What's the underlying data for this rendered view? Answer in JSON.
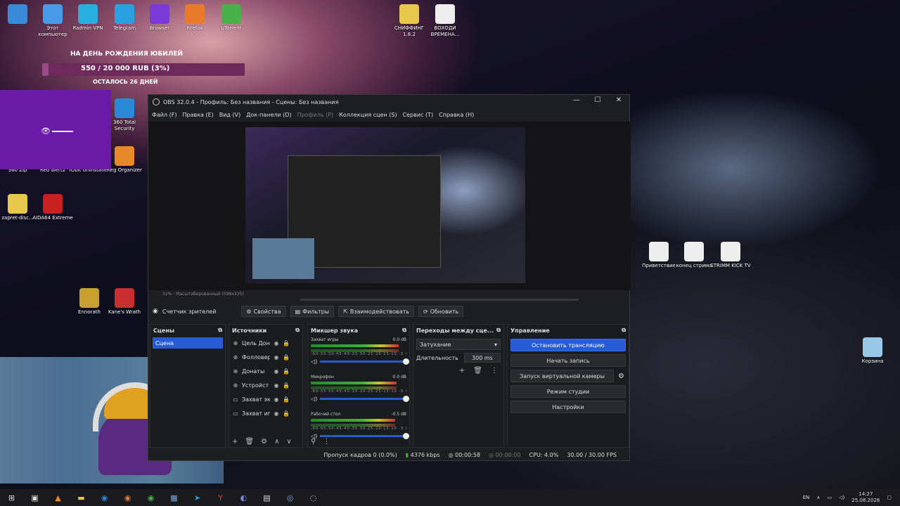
{
  "desktop": {
    "icons_top": [
      {
        "label": "",
        "color": "#3a8ad8"
      },
      {
        "label": "Этот компьютер",
        "color": "#4a9ae8"
      },
      {
        "label": "Radmin VPN",
        "color": "#2ab0e0"
      },
      {
        "label": "Telegram",
        "color": "#2aa0e0"
      },
      {
        "label": "Browser",
        "color": "#7a3ad8"
      },
      {
        "label": "Firefox",
        "color": "#e87a2a"
      },
      {
        "label": "µTorrent",
        "color": "#4ab04a"
      }
    ],
    "icons_top_right": [
      {
        "label": "СНИФФИНГ 1.8.2",
        "color": "#e8c84a"
      },
      {
        "label": "ВОХОДИ ВРЕМЕНА...",
        "color": "#eeeeee"
      }
    ],
    "icons_left": [
      {
        "label": "360 Total Security",
        "color": "#2a8ad8"
      },
      {
        "label": "Reg Organizer",
        "color": "#e88a2a"
      },
      {
        "label": "360 Zip",
        "color": "#3a6ad8"
      },
      {
        "label": "Red alert2",
        "color": "#c83030"
      },
      {
        "label": "IObit Uninstaller",
        "color": "#2ab04a"
      },
      {
        "label": "zapret-disc...",
        "color": "#e8c84a"
      },
      {
        "label": "AIDA64 Extreme",
        "color": "#c82020"
      },
      {
        "label": "Ennorath",
        "color": "#c8a030"
      },
      {
        "label": "Kane's Wrath",
        "color": "#c83030"
      }
    ],
    "icons_right": [
      {
        "label": "Приветствие",
        "color": "#eeeeee"
      },
      {
        "label": "конец стрима",
        "color": "#eeeeee"
      },
      {
        "label": "STRIMM KICK TV",
        "color": "#eeeeee"
      },
      {
        "label": "Корзина",
        "color": "#9ac8e8"
      }
    ]
  },
  "donation": {
    "title": "НА ДЕНЬ РОЖДЕНИЯ ЮБИЛЕЙ",
    "progress_text": "550 / 20 000 RUB (3%)",
    "progress_fraction": 0.03,
    "days_left": "ОСТАЛОСЬ 26 ДНЕЙ",
    "bar_color": "#9a4a86"
  },
  "obs": {
    "window_title": "OBS 32.0.4 - Профиль: Без названия - Сцены: Без названия",
    "menu": [
      "Файл (F)",
      "Правка (E)",
      "Вид (V)",
      "Док-панели (D)",
      "Профиль (P)",
      "Коллекция сцен (S)",
      "Сервис (T)",
      "Справка (H)"
    ],
    "preview_status": "31% · Масштабированный (596x335)",
    "toolbar": {
      "current_source": "Счетчик зрителей",
      "properties": "Свойства",
      "filters": "Фильтры",
      "interact": "Взаимодействовать",
      "refresh": "Обновить"
    },
    "scenes": {
      "title": "Сцены",
      "items": [
        "Сцена"
      ]
    },
    "sources": {
      "title": "Источники",
      "items": [
        "Цель Дон",
        "Фолловер",
        "Донаты",
        "Устройст",
        "Захват эк",
        "Захват иг"
      ]
    },
    "mixer": {
      "title": "Микшер звука",
      "channels": [
        {
          "name": "Захват игры",
          "db": "0.0 dB",
          "level": 0.92
        },
        {
          "name": "Микрофон",
          "db": "0.0 dB",
          "level": 0.9
        },
        {
          "name": "Рабочий стол",
          "db": "-0.5 dB",
          "level": 0.88
        }
      ],
      "ticks": "-60-55-50-45-40-35-30-25-20-15-10 -5 0"
    },
    "transitions": {
      "title": "Переходы между сце...",
      "selected": "Затухание",
      "duration_label": "Длительность",
      "duration_value": "300 ms"
    },
    "controls": {
      "title": "Управление",
      "stop_stream": "Остановить трансляцию",
      "start_record": "Начать запись",
      "virtual_camera": "Запуск виртуальной камеры",
      "studio_mode": "Режим студии",
      "settings": "Настройки"
    },
    "statusbar": {
      "dropped": "Пропуск кадров 0 (0.0%)",
      "bitrate": "4376 kbps",
      "stream_time": "00:00:58",
      "rec_time": "00:00:00",
      "cpu": "CPU: 4.0%",
      "fps": "30.00 / 30.00 FPS"
    }
  },
  "taskbar": {
    "lang": "EN",
    "time": "14:27",
    "date": "25.08.2026"
  }
}
